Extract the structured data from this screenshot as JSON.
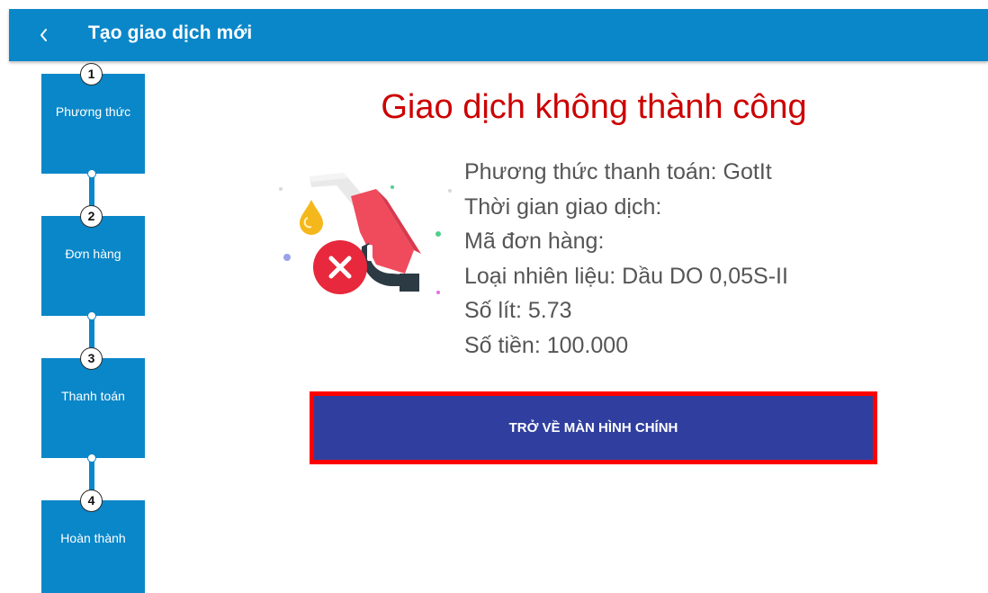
{
  "appbar": {
    "back_icon": "chevron-left-icon",
    "title": "Tạo giao dịch mới"
  },
  "stepper": {
    "steps": [
      {
        "number": "1",
        "label": "Phương thức"
      },
      {
        "number": "2",
        "label": "Đơn hàng"
      },
      {
        "number": "3",
        "label": "Thanh toán"
      },
      {
        "number": "4",
        "label": "Hoàn thành"
      }
    ]
  },
  "result": {
    "title": "Giao dịch không thành công",
    "illustration_icon": "fuel-nozzle-error-icon",
    "details": [
      "Phương thức thanh toán: GotIt",
      "Thời gian giao dịch:",
      "Mã đơn hàng:",
      "Loại nhiên liệu: Dầu DO 0,05S-II",
      "Số lít: 5.73",
      "Số tiền: 100.000"
    ]
  },
  "actions": {
    "home_button_label": "TRỞ VỀ MÀN HÌNH CHÍNH"
  },
  "colors": {
    "primary": "#0a87c9",
    "error_text": "#cc0000",
    "button_bg": "#303f9f",
    "highlight_border": "#ff0000"
  }
}
